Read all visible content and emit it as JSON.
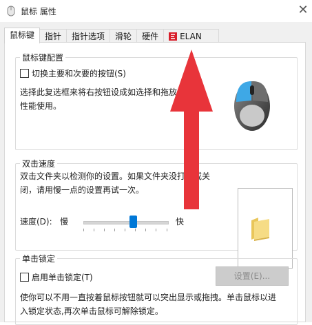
{
  "window": {
    "title": "鼠标 属性",
    "close_glyph": "✕"
  },
  "tabs": [
    {
      "label": "鼠标键",
      "active": true
    },
    {
      "label": "指针"
    },
    {
      "label": "指针选项"
    },
    {
      "label": "滑轮"
    },
    {
      "label": "硬件"
    },
    {
      "label": "ELAN",
      "icon": "elan-icon"
    }
  ],
  "button_config": {
    "title": "鼠标键配置",
    "checkbox_label": "切换主要和次要的按钮(S)",
    "description_line1": "选择此复选框来将右按钮设成如选择和拖放",
    "description_line2": "性能使用。"
  },
  "double_click": {
    "title": "双击速度",
    "description_line1": "双击文件夹以检测你的设置。如果文件夹没打开或关",
    "description_line2": "闭，请用慢一点的设置再试一次。",
    "speed_label": "速度(D):",
    "slow_label": "慢",
    "fast_label": "快",
    "speed_value": 0.6
  },
  "click_lock": {
    "title": "单击锁定",
    "checkbox_label": "启用单击锁定(T)",
    "settings_button": "设置(E)...",
    "description_line1": "使你可以不用一直按着鼠标按钮就可以突出显示或拖拽。单击鼠标以进",
    "description_line2": "入锁定状态,再次单击鼠标可解除锁定。"
  },
  "colors": {
    "accent": "#0078d7",
    "arrow": "#e8343a"
  }
}
